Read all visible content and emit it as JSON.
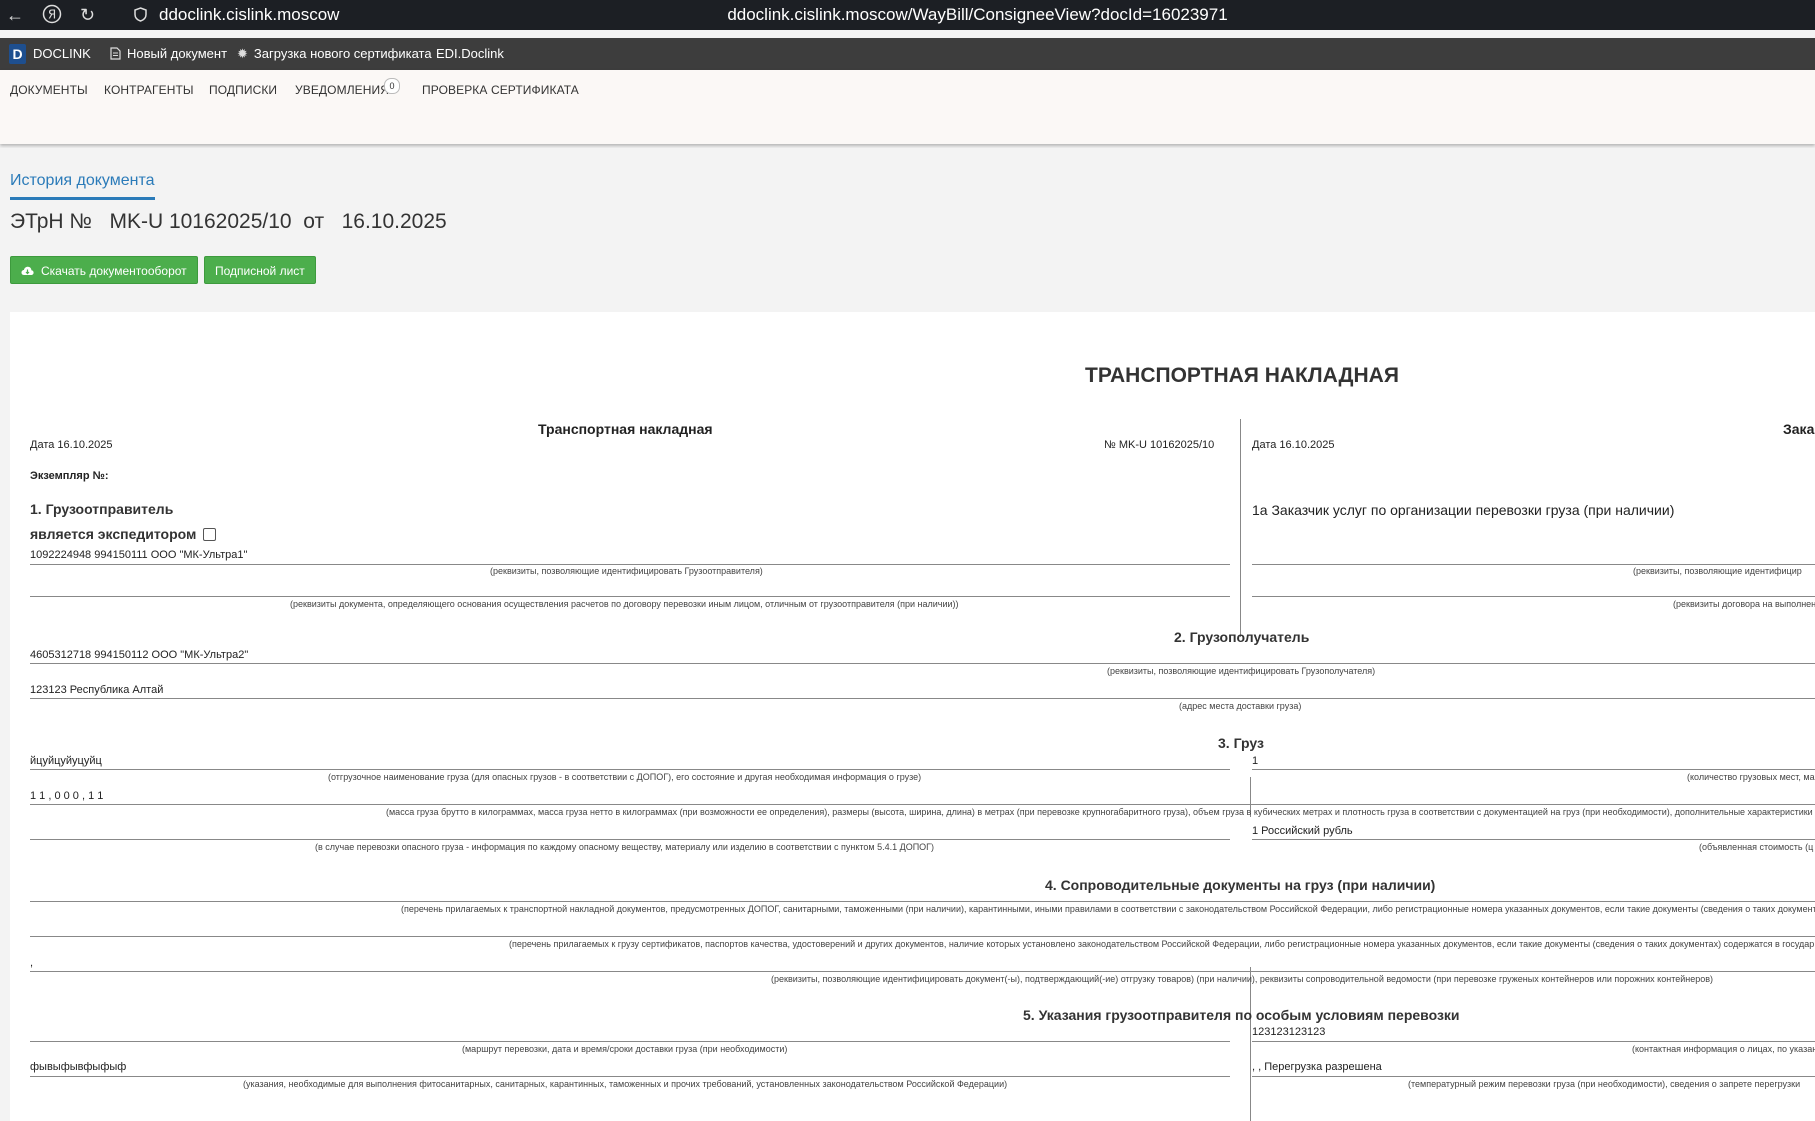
{
  "browser": {
    "domain": "ddoclink.cislink.moscow",
    "full_url": "ddoclink.cislink.moscow/WayBill/ConsigneeView?docId=16023971",
    "back_icon": "arrow-left-icon",
    "yandex_icon": "yandex-icon",
    "reload_icon": "reload-icon"
  },
  "appbar": {
    "logo_letter": "D",
    "brand": "DOCLINK",
    "new_document": "Новый документ",
    "upload_cert": "Загрузка нового сертификата",
    "edi": "EDI.Doclink"
  },
  "menu": {
    "documents": "ДОКУМЕНТЫ",
    "counterparties": "КОНТРАГЕНТЫ",
    "signatures": "ПОДПИСКИ",
    "notifications": "УВЕДОМЛЕНИЯ",
    "notifications_count": "0",
    "cert_check": "ПРОВЕРКА СЕРТИФИКАТА"
  },
  "page": {
    "history_tab": "История документа",
    "doc_title": "ЭТрН №   MK-U 10162025/10  от   16.10.2025",
    "download_btn": "Скачать документооборот",
    "sign_sheet_btn": "Подписной лист"
  },
  "sheet": {
    "title": "ТРАНСПОРТНАЯ НАКЛАДНАЯ",
    "left_header": "Транспортная накладная",
    "date_left": "Дата  16.10.2025",
    "number": "№   MK-U 10162025/10",
    "date_right": "Дата 16.10.2025",
    "right_header_partial": "Зака",
    "copy_label": "Экземпляр №:",
    "s1_title": "1. Грузоотправитель",
    "s1_forwarder": "является экспедитором",
    "s1_value": "1092224948 994150111 ООО \"МК-Ультра1\"",
    "s1_cap1": "(реквизиты, позволяющие идентифицировать Грузоотправителя)",
    "s1_cap2": "(реквизиты документа, определяющего основания осуществления расчетов по договору перевозки иным лицом, отличным от грузоотправителя (при наличии))",
    "s1a_title": "1а Заказчик услуг по организации перевозки груза (при наличии)",
    "s1a_cap1": "(реквизиты, позволяющие идентифицир",
    "s1a_cap2": "(реквизиты договора на выполнен",
    "s2_title": "2. Грузополучатель",
    "s2_value1": "4605312718 994150112 ООО \"МК-Ультра2\"",
    "s2_cap1": "(реквизиты, позволяющие идентифицировать Грузополучателя)",
    "s2_value2": "123123 Республика Алтай",
    "s2_cap2": "(адрес места доставки груза)",
    "s3_title": "3. Груз",
    "s3_value1": "йцуйцуйуцуйц",
    "s3_cap1": "(отгрузочное наименование груза (для опасных грузов - в соответствии с ДОПОГ), его состояние и другая необходимая информация о грузе)",
    "s3_qty": "1",
    "s3_qty_cap": "(количество грузовых мест, ма",
    "s3_value2": "1 1 , 0 0 0 , 1 1",
    "s3_cap2": "(масса груза брутто в килограммах, масса груза нетто в килограммах (при возможности ее определения), размеры (высота, ширина, длина) в метрах (при перевозке крупногабаритного груза), объем груза в кубических метрах и плотность груза в соответствии с документацией на груз (при необходимости), дополнительные характеристики г",
    "s3_cap3": "(в случае перевозки опасного груза - информация по каждому опасному веществу, материалу или изделию в соответствии с пунктом 5.4.1 ДОПОГ)",
    "s3_price": "1 Российский рубль",
    "s3_price_cap": "(объявленная стоимость (ц",
    "s4_title": "4. Сопроводительные документы на груз (при наличии)",
    "s4_cap1": "(перечень прилагаемых к транспортной накладной документов, предусмотренных ДОПОГ, санитарными, таможенными (при наличии), карантинными, иными правилами в соответствии с законодательством Российской Федерации, либо регистрационные номера указанных документов, если такие документы (сведения о таких документ",
    "s4_cap2": "(перечень прилагаемых к грузу сертификатов, паспортов качества, удостоверений и других документов, наличие которых установлено законодательством Российской Федерации, либо регистрационные номера указанных документов, если такие документы (сведения о таких документах) содержатся в государ",
    "s4_value3": ",",
    "s4_cap3": "(реквизиты, позволяющие идентифицировать документ(-ы), подтверждающий(-ие) отгрузку товаров) (при наличии), реквизиты сопроводительной ведомости (при перевозке груженых контейнеров или порожних контейнеров)",
    "s5_title": "5. Указания грузоотправителя по особым условиям перевозки",
    "s5_right_value1": "123123123123",
    "s5_cap1": "(маршрут перевозки, дата и время/сроки доставки груза (при необходимости)",
    "s5_right_cap1": "(контактная информация о лицах, по указан",
    "s5_value2": "фывыфывфыфыф",
    "s5_right_value2": ", , Перегрузка разрешена",
    "s5_cap2": "(указания, необходимые для выполнения фитосанитарных, санитарных, карантинных, таможенных и прочих требований, установленных законодательством Российской Федерации)",
    "s5_right_cap2": "(температурный режим перевозки груза (при необходимости), сведения о запрете перегрузки"
  }
}
